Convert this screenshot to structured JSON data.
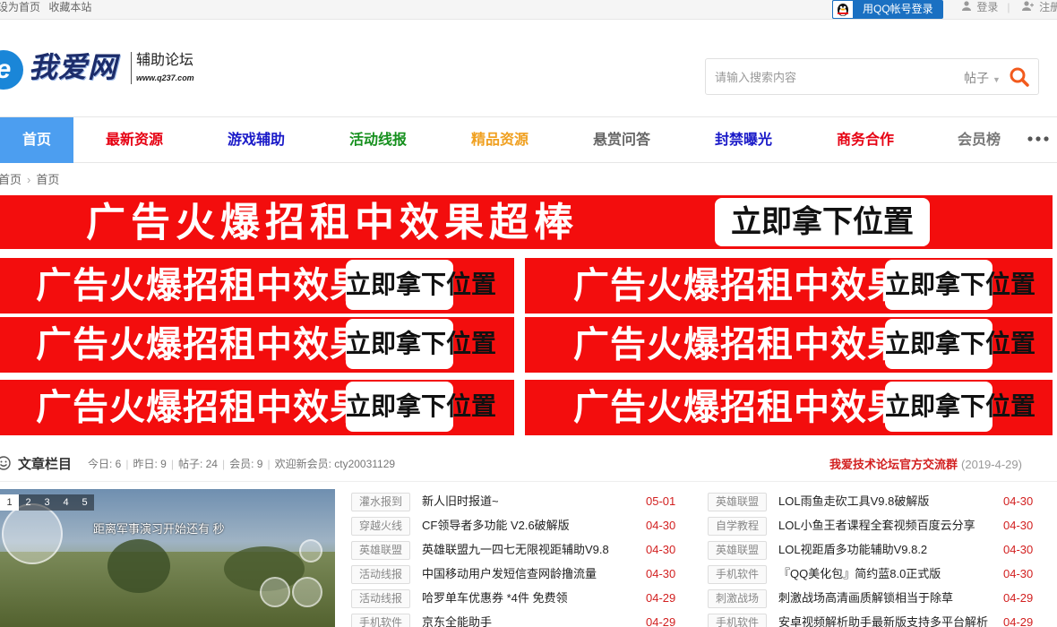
{
  "topbar": {
    "home": "设为首页",
    "bookmark": "收藏本站",
    "qq_login": "用QQ帐号登录",
    "login": "登录",
    "register": "注册"
  },
  "header": {
    "logo_text": "我爱网",
    "logo_sub": "辅助论坛",
    "logo_url": "www.q237.com",
    "search": {
      "placeholder": "请输入搜索内容",
      "scope": "帖子"
    }
  },
  "nav": {
    "items": [
      {
        "label": "首页",
        "color": "#ffffff"
      },
      {
        "label": "最新资源",
        "color": "#e60012"
      },
      {
        "label": "游戏辅助",
        "color": "#1a1ac8"
      },
      {
        "label": "活动线报",
        "color": "#16901e"
      },
      {
        "label": "精品资源",
        "color": "#f0a020"
      },
      {
        "label": "悬赏问答",
        "color": "#666666"
      },
      {
        "label": "封禁曝光",
        "color": "#1a1ac8"
      },
      {
        "label": "商务合作",
        "color": "#e60012"
      },
      {
        "label": "会员榜",
        "color": "#777777"
      }
    ]
  },
  "breadcrumb": {
    "items": [
      "首页",
      "首页"
    ]
  },
  "ads": {
    "text": "广告火爆招租中效果超棒",
    "cta": "立即拿下位置"
  },
  "section": {
    "title": "文章栏目",
    "stats": {
      "today": "今日: 6",
      "yesterday": "昨日: 9",
      "posts": "帖子: 24",
      "members": "会员: 9",
      "welcome": "欢迎新会员: cty20031129"
    },
    "notice": "我爱技术论坛官方交流群",
    "notice_date": "(2019-4-29)"
  },
  "slideshow": {
    "pages": [
      "1",
      "2",
      "3",
      "4",
      "5"
    ],
    "caption": "距离军事演习开始还有  秒"
  },
  "articles_left": [
    {
      "tag": "灌水报到",
      "title": "新人旧时报道~",
      "date": "05-01"
    },
    {
      "tag": "穿越火线",
      "title": "CF领导者多功能 V2.6破解版",
      "date": "04-30"
    },
    {
      "tag": "英雄联盟",
      "title": "英雄联盟九一四七无限视距辅助V9.8",
      "date": "04-30"
    },
    {
      "tag": "活动线报",
      "title": "中国移动用户发短信查网龄撸流量",
      "date": "04-30"
    },
    {
      "tag": "活动线报",
      "title": "哈罗单车优惠券 *4件 免费领",
      "date": "04-29"
    },
    {
      "tag": "手机软件",
      "title": "京东全能助手",
      "date": "04-29"
    }
  ],
  "articles_right": [
    {
      "tag": "英雄联盟",
      "title": "LOL雨鱼走砍工具V9.8破解版",
      "date": "04-30"
    },
    {
      "tag": "自学教程",
      "title": "LOL小鱼王者课程全套视频百度云分享",
      "date": "04-30"
    },
    {
      "tag": "英雄联盟",
      "title": "LOL视距盾多功能辅助V9.8.2",
      "date": "04-30"
    },
    {
      "tag": "手机软件",
      "title": "『QQ美化包』简约蓝8.0正式版",
      "date": "04-30"
    },
    {
      "tag": "刺激战场",
      "title": "刺激战场高清画质解锁相当于除草",
      "date": "04-29"
    },
    {
      "tag": "手机软件",
      "title": "安卓视频解析助手最新版支持多平台解析",
      "date": "04-29"
    }
  ]
}
